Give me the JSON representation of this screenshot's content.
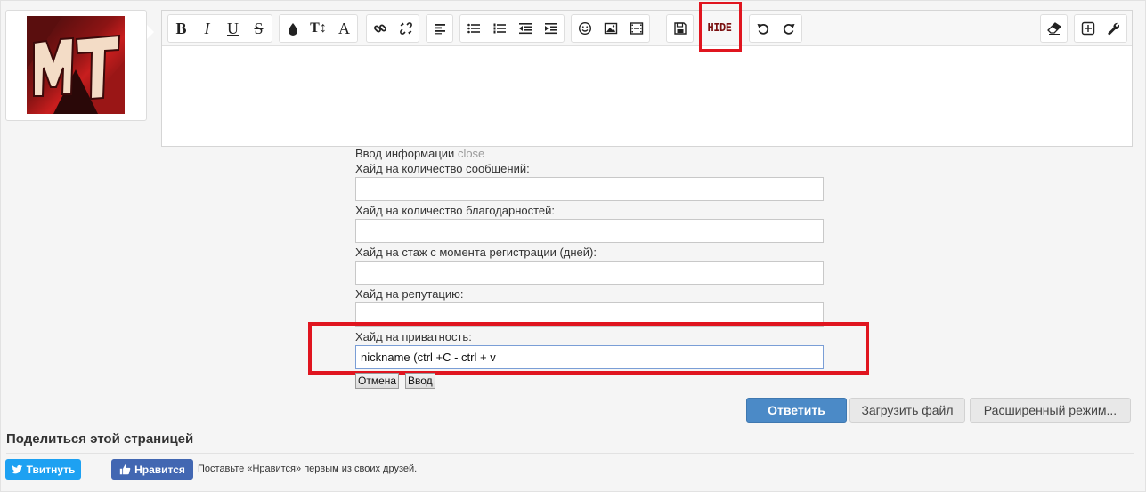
{
  "toolbar": {
    "bold": "B",
    "italic": "I",
    "underline": "U",
    "strike": "S",
    "font_size": "T↕",
    "font_family": "A",
    "hide": "HIDE"
  },
  "form": {
    "heading": "Ввод информации",
    "close": "close",
    "fields": [
      {
        "label": "Хайд на количество сообщений:",
        "value": ""
      },
      {
        "label": "Хайд на количество благодарностей:",
        "value": ""
      },
      {
        "label": "Хайд на стаж с момента регистрации (дней):",
        "value": ""
      },
      {
        "label": "Хайд на репутацию:",
        "value": ""
      },
      {
        "label": "Хайд на приватность:",
        "value": "nickname (ctrl +C - ctrl + v"
      }
    ],
    "cancel": "Отмена",
    "submit": "Ввод"
  },
  "actions": {
    "reply": "Ответить",
    "upload": "Загрузить файл",
    "advanced": "Расширенный режим..."
  },
  "share": {
    "title": "Поделиться этой страницей",
    "tweet": "Твитнуть",
    "like": "Нравится",
    "like_text": "Поставьте «Нравится» первым из своих друзей."
  },
  "colors": {
    "primary_button": "#4b8ac7",
    "highlight": "#e0151f",
    "twitter": "#1da1f2",
    "facebook": "#4267b2"
  }
}
